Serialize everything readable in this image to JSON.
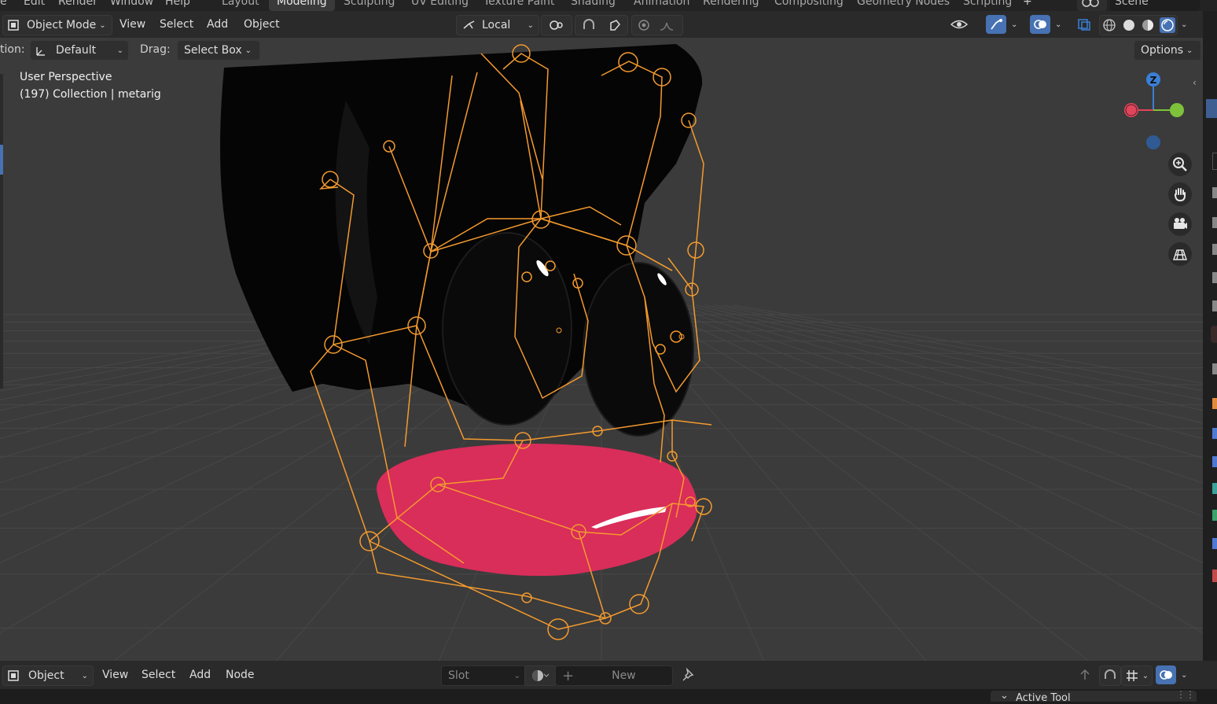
{
  "topbar": {
    "menus": [
      "e",
      "Edit",
      "Render",
      "Window",
      "Help"
    ],
    "workspaces": [
      "Layout",
      "Modeling",
      "Sculpting",
      "UV Editing",
      "Texture Paint",
      "Shading",
      "Animation",
      "Rendering",
      "Compositing",
      "Geometry Nodes",
      "Scripting"
    ],
    "active_workspace": "Modeling",
    "add_workspace": "+",
    "scene_name": "Scene"
  },
  "header": {
    "mode": "Object Mode",
    "menus": [
      "View",
      "Select",
      "Add",
      "Object"
    ],
    "transform_orientation": "Local"
  },
  "tool_settings": {
    "orientation_label": "tion:",
    "orientation_value": "Default",
    "drag_label": "Drag:",
    "drag_value": "Select Box",
    "options_label": "Options"
  },
  "viewport": {
    "perspective": "User Perspective",
    "collection_info": "(197) Collection | metarig",
    "gizmo_axis_label": "Z",
    "colors": {
      "background": "#3b3b3b",
      "grid": "#474747",
      "bones": "#f49a2e",
      "lips": "#d92d5a",
      "axis_x": "#e0465b",
      "axis_y": "#7ec23b",
      "axis_z": "#3b7fd6"
    }
  },
  "nav_tools": [
    "zoom-icon",
    "hand-pan-icon",
    "camera-icon",
    "grid-ortho-icon"
  ],
  "bottom": {
    "editor_type": "Object",
    "menus": [
      "View",
      "Select",
      "Add",
      "Node"
    ],
    "slot_label": "Slot",
    "new_label": "New",
    "panel_title": "Active Tool"
  }
}
